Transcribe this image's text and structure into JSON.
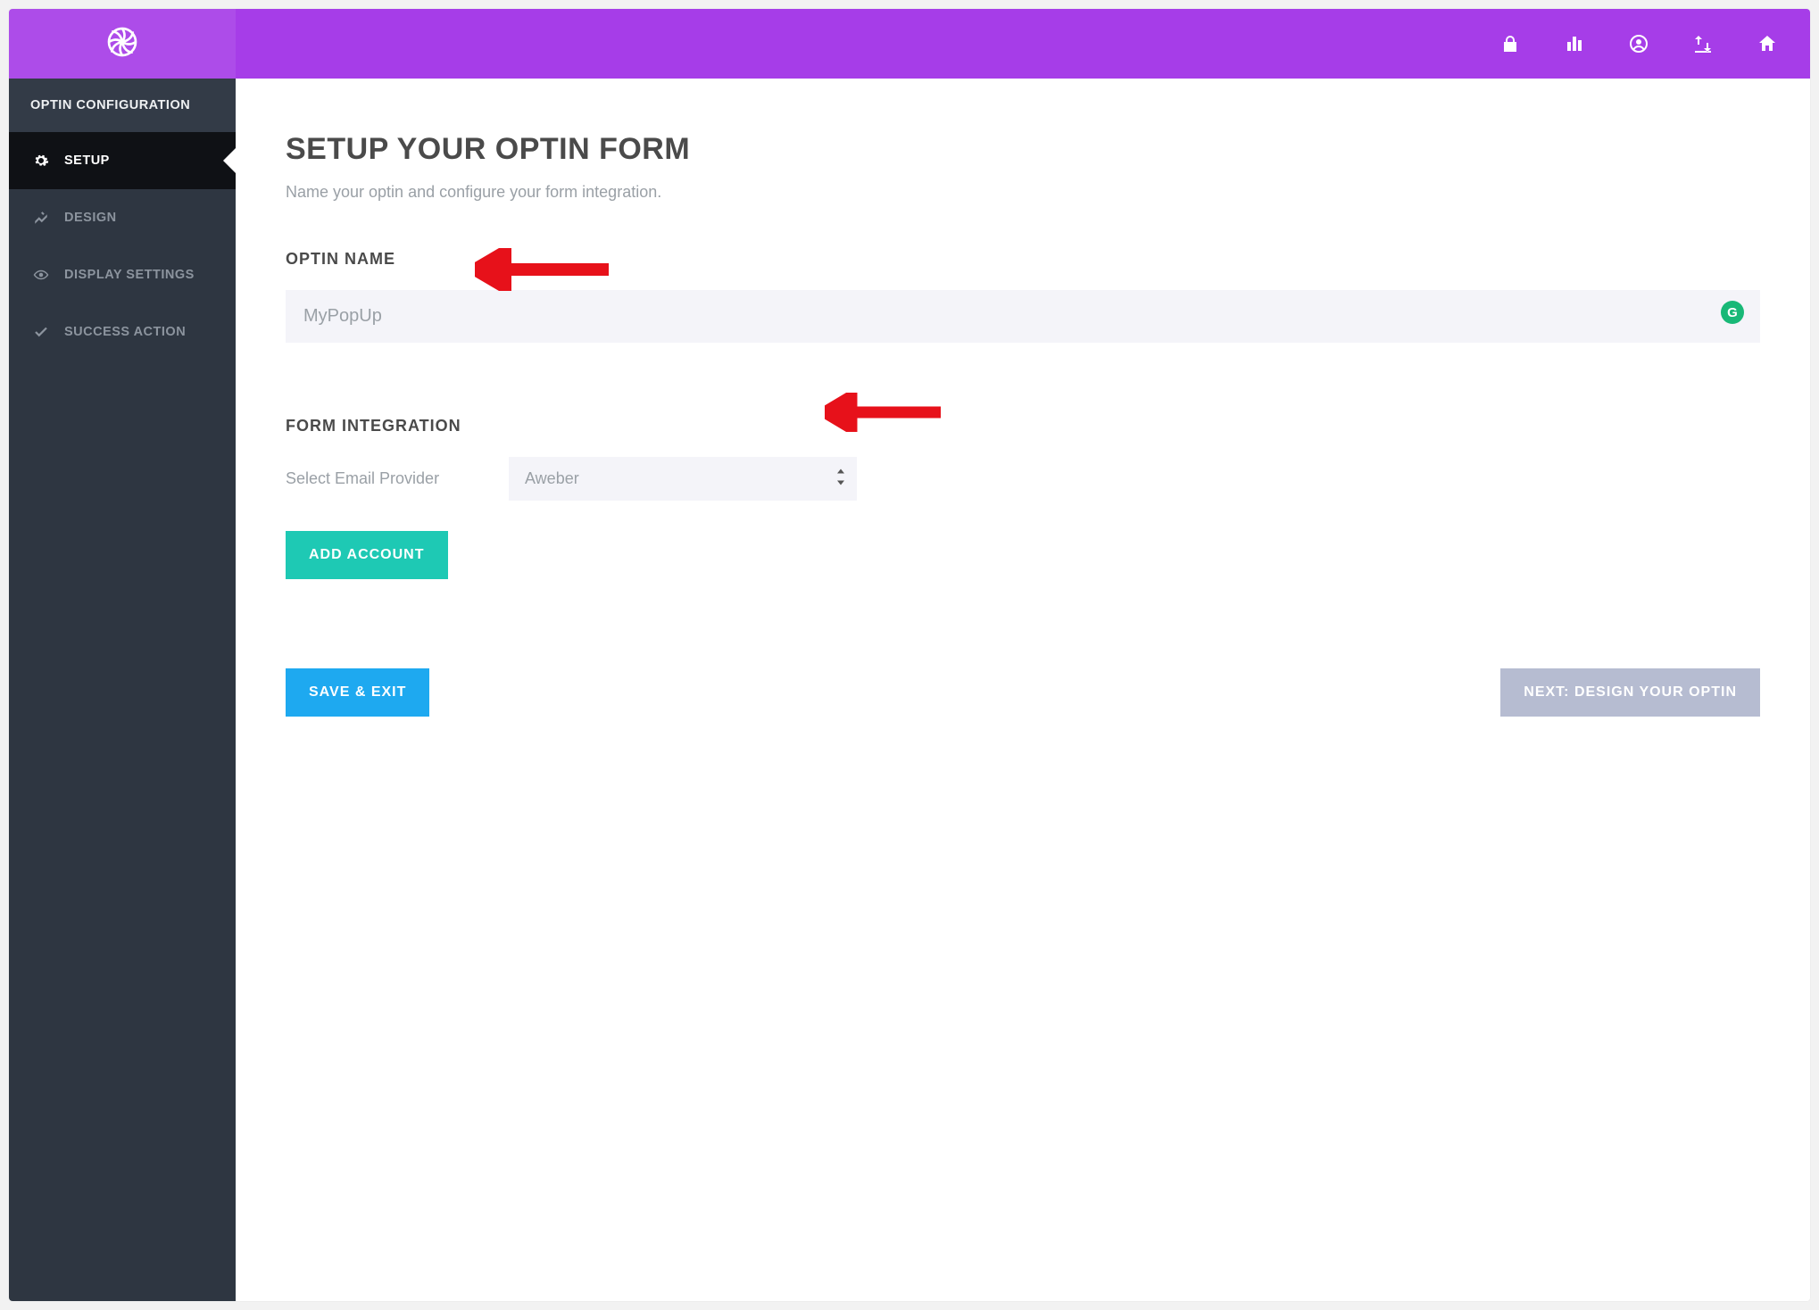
{
  "header": {
    "icons": [
      "lock-icon",
      "chart-icon",
      "profile-icon",
      "import-export-icon",
      "home-icon"
    ]
  },
  "sidebar": {
    "title": "OPTIN CONFIGURATION",
    "items": [
      {
        "label": "SETUP",
        "icon": "gear-icon",
        "active": true
      },
      {
        "label": "DESIGN",
        "icon": "design-icon",
        "active": false
      },
      {
        "label": "DISPLAY SETTINGS",
        "icon": "eye-icon",
        "active": false
      },
      {
        "label": "SUCCESS ACTION",
        "icon": "check-icon",
        "active": false
      }
    ]
  },
  "main": {
    "title": "SETUP YOUR OPTIN FORM",
    "subtitle": "Name your optin and configure your form integration.",
    "optin_name_label": "OPTIN NAME",
    "optin_name_value": "MyPopUp",
    "form_integration_label": "FORM INTEGRATION",
    "email_provider_label": "Select Email Provider",
    "email_provider_value": "Aweber",
    "add_account_label": "ADD ACCOUNT",
    "save_exit_label": "SAVE & EXIT",
    "next_label": "NEXT: DESIGN YOUR OPTIN"
  },
  "colors": {
    "brand_purple": "#a63de8",
    "teal": "#1ec9b4",
    "blue": "#1ea9f0",
    "muted": "#b6bcd1"
  }
}
